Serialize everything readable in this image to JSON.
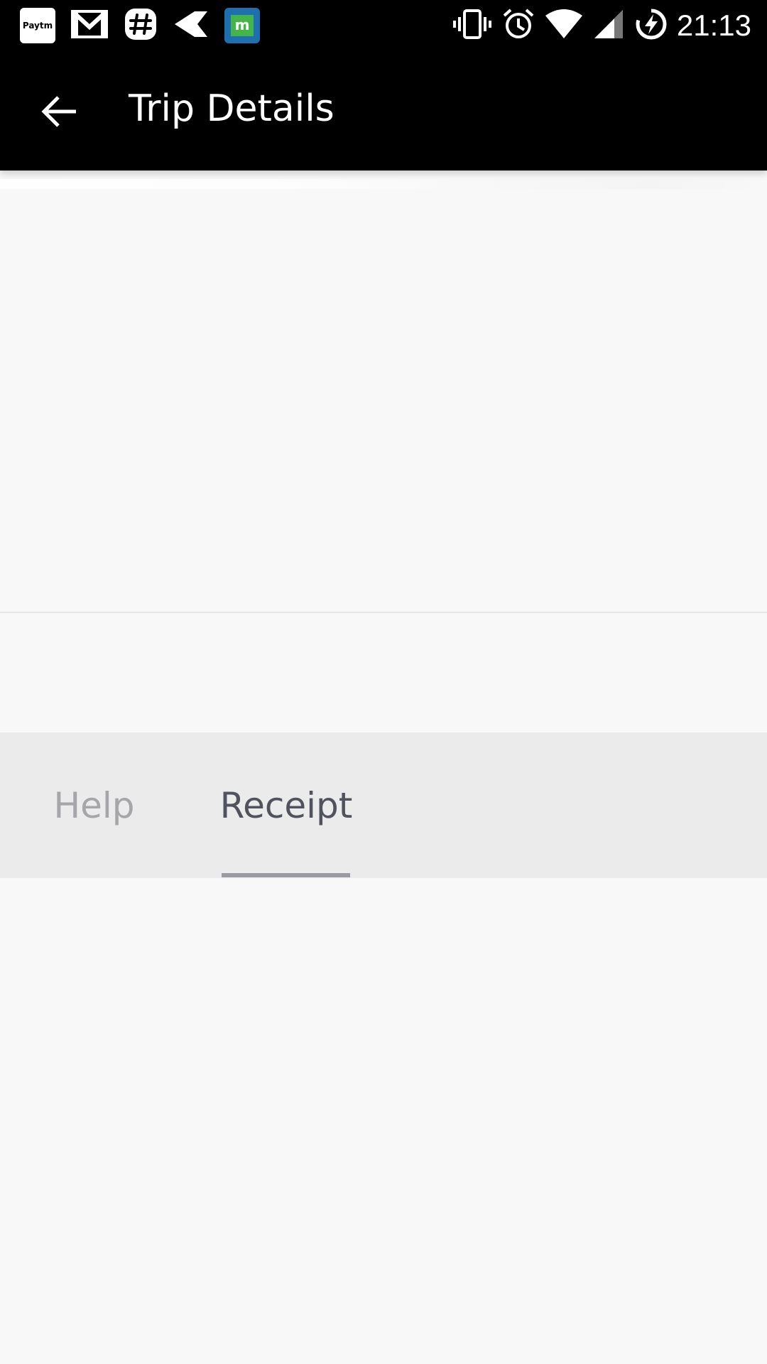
{
  "status_bar": {
    "time": "21:13",
    "notification_icons": [
      "paytm-icon",
      "gmail-icon",
      "slack-icon",
      "arrow-app-icon",
      "matrix-app-icon"
    ],
    "system_icons": [
      "vibrate-icon",
      "alarm-icon",
      "wifi-icon",
      "cell-signal-icon",
      "battery-charging-icon"
    ],
    "paytm_label": "Paytm",
    "matrix_label": "m"
  },
  "toolbar": {
    "title": "Trip Details",
    "background": "#000000"
  },
  "tabs": {
    "items": [
      {
        "label": "Help",
        "selected": false
      },
      {
        "label": "Receipt",
        "selected": true
      }
    ],
    "selected_color": "#50525d",
    "unselected_color": "#a6a6aa"
  }
}
